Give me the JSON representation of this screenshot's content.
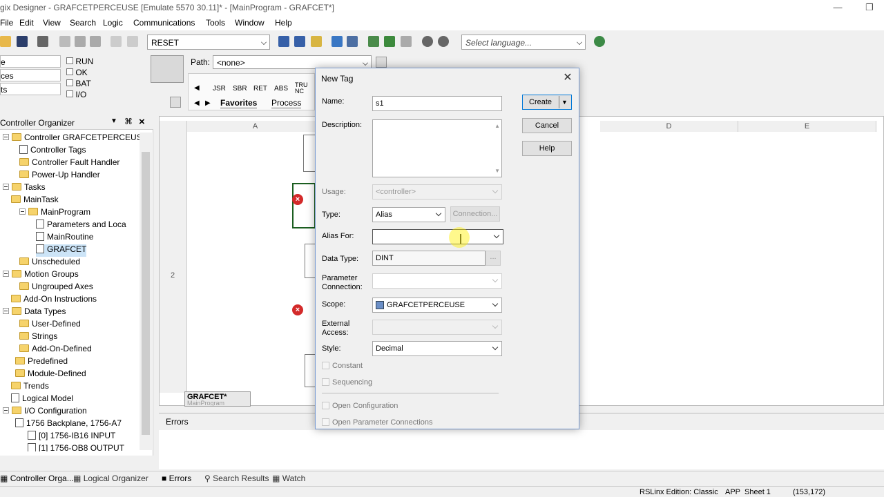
{
  "window": {
    "title": "gix Designer - GRAFCETPERCEUSE [Emulate 5570 30.11]* - [MainProgram - GRAFCET*]"
  },
  "menu": [
    "File",
    "Edit",
    "View",
    "Search",
    "Logic",
    "Communications",
    "Tools",
    "Window",
    "Help"
  ],
  "toolbar": {
    "reset_combo": "RESET",
    "language_placeholder": "Select language..."
  },
  "status": {
    "left_items": [
      "e",
      "ces",
      "ts"
    ],
    "indicators": [
      "RUN",
      "OK",
      "BAT",
      "I/O"
    ]
  },
  "path": {
    "label": "Path:",
    "value": "<none>"
  },
  "instructions": [
    "JSR",
    "SBR",
    "RET",
    "ABS",
    "TRU NC"
  ],
  "instr_tabs": [
    "Favorites",
    "Process"
  ],
  "organizer": {
    "title": "Controller Organizer",
    "items": [
      {
        "label": "Controller GRAFCETPERCEUSE",
        "indent": 0,
        "icon": "folder"
      },
      {
        "label": "Controller Tags",
        "indent": 2,
        "icon": "doc"
      },
      {
        "label": "Controller Fault Handler",
        "indent": 2,
        "icon": "folder"
      },
      {
        "label": "Power-Up Handler",
        "indent": 2,
        "icon": "folder"
      },
      {
        "label": "Tasks",
        "indent": 0,
        "icon": "folder"
      },
      {
        "label": "MainTask",
        "indent": 1,
        "icon": "folder"
      },
      {
        "label": "MainProgram",
        "indent": 2,
        "icon": "folder"
      },
      {
        "label": "Parameters and Loca",
        "indent": 4,
        "icon": "doc"
      },
      {
        "label": "MainRoutine",
        "indent": 4,
        "icon": "doc"
      },
      {
        "label": "GRAFCET",
        "indent": 4,
        "icon": "doc",
        "selected": true
      },
      {
        "label": "Unscheduled",
        "indent": 2,
        "icon": "folder"
      },
      {
        "label": "Motion Groups",
        "indent": 0,
        "icon": "folder"
      },
      {
        "label": "Ungrouped Axes",
        "indent": 2,
        "icon": "folder"
      },
      {
        "label": "Add-On Instructions",
        "indent": 1,
        "icon": "folder"
      },
      {
        "label": "Data Types",
        "indent": 0,
        "icon": "folder"
      },
      {
        "label": "User-Defined",
        "indent": 2,
        "icon": "folder"
      },
      {
        "label": "Strings",
        "indent": 2,
        "icon": "folder"
      },
      {
        "label": "Add-On-Defined",
        "indent": 2,
        "icon": "folder"
      },
      {
        "label": "Predefined",
        "indent": 1.5,
        "icon": "folder"
      },
      {
        "label": "Module-Defined",
        "indent": 1.5,
        "icon": "folder"
      },
      {
        "label": "Trends",
        "indent": 1,
        "icon": "folder"
      },
      {
        "label": "Logical Model",
        "indent": 1,
        "icon": "doc"
      },
      {
        "label": "I/O Configuration",
        "indent": 0,
        "icon": "folder"
      },
      {
        "label": "1756 Backplane, 1756-A7",
        "indent": 1.5,
        "icon": "doc"
      },
      {
        "label": "[0] 1756-IB16 INPUT",
        "indent": 3,
        "icon": "doc"
      },
      {
        "label": "[1] 1756-OB8 OUTPUT",
        "indent": 3,
        "icon": "doc"
      }
    ]
  },
  "ladder": {
    "columns": [
      "A",
      "D",
      "E"
    ],
    "row_label": "2",
    "sheet_tab": "GRAFCET*",
    "sheet_sub": "MainProgram"
  },
  "errors": {
    "title": "Errors"
  },
  "bottom_tabs": [
    "Controller Orga...",
    "Logical Organizer",
    "Errors",
    "Search Results",
    "Watch"
  ],
  "statusbar": {
    "edition": "RSLinx Edition: Classic",
    "app": "APP",
    "sheet": "Sheet 1",
    "coords": "(153,172)"
  },
  "dialog": {
    "title": "New Tag",
    "name_label": "Name:",
    "name_value": "s1",
    "description_label": "Description:",
    "usage_label": "Usage:",
    "usage_value": "<controller>",
    "type_label": "Type:",
    "type_value": "Alias",
    "connection_button": "Connection...",
    "alias_label": "Alias For:",
    "datatype_label": "Data Type:",
    "datatype_value": "DINT",
    "param_label": "Parameter Connection:",
    "scope_label": "Scope:",
    "scope_value": "GRAFCETPERCEUSE",
    "external_label": "External Access:",
    "style_label": "Style:",
    "style_value": "Decimal",
    "constant_label": "Constant",
    "sequencing_label": "Sequencing",
    "open_config_label": "Open Configuration",
    "open_param_label": "Open Parameter Connections",
    "create_button": "Create",
    "cancel_button": "Cancel",
    "help_button": "Help"
  }
}
